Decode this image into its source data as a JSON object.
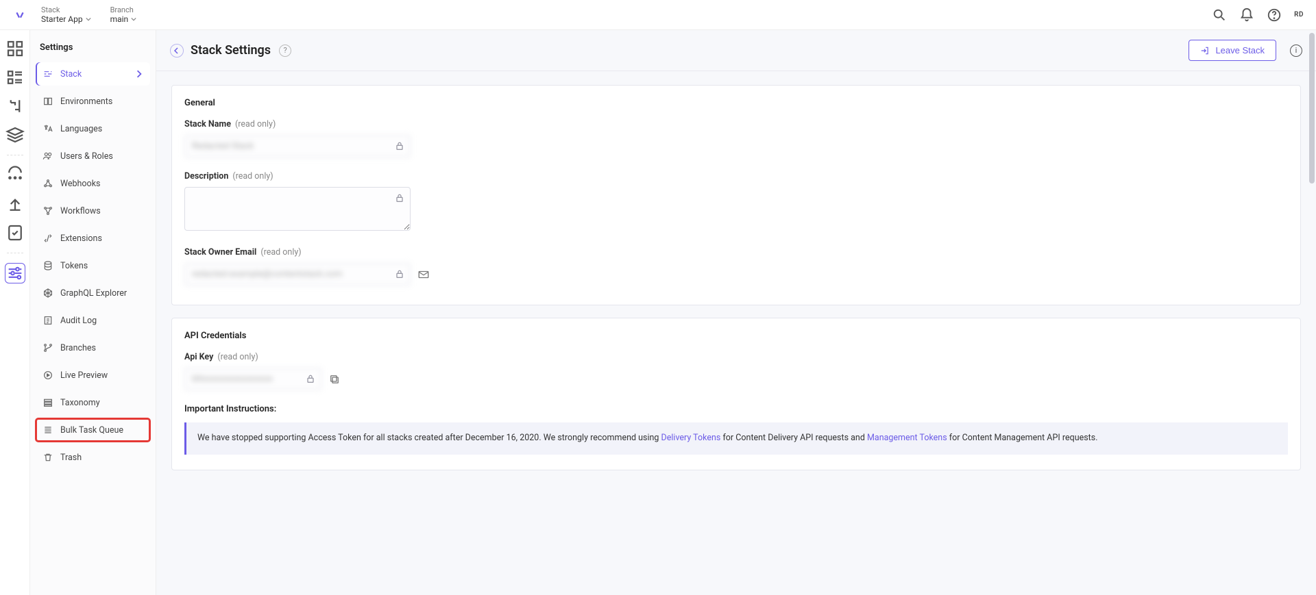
{
  "top": {
    "stack_label": "Stack",
    "stack_value": "Starter App",
    "branch_label": "Branch",
    "branch_value": "main",
    "avatar": "RD"
  },
  "sidebar": {
    "title": "Settings",
    "items": [
      {
        "label": "Stack"
      },
      {
        "label": "Environments"
      },
      {
        "label": "Languages"
      },
      {
        "label": "Users & Roles"
      },
      {
        "label": "Webhooks"
      },
      {
        "label": "Workflows"
      },
      {
        "label": "Extensions"
      },
      {
        "label": "Tokens"
      },
      {
        "label": "GraphQL Explorer"
      },
      {
        "label": "Audit Log"
      },
      {
        "label": "Branches"
      },
      {
        "label": "Live Preview"
      },
      {
        "label": "Taxonomy"
      },
      {
        "label": "Bulk Task Queue"
      },
      {
        "label": "Trash"
      }
    ]
  },
  "page": {
    "title": "Stack Settings",
    "leave_label": "Leave Stack",
    "general": {
      "title": "General",
      "stack_name_label": "Stack Name",
      "readonly": "(read only)",
      "stack_name_value": "Redacted Stack",
      "description_label": "Description",
      "description_value": "",
      "owner_label": "Stack Owner Email",
      "owner_value": "redacted.example@contentstack.com"
    },
    "api": {
      "title": "API Credentials",
      "api_key_label": "Api Key",
      "api_key_value": "bltxxxxxxxxxxxxxxxx",
      "instr_title": "Important Instructions:",
      "note_p1": "We have stopped supporting Access Token for all stacks created after December 16, 2020. We strongly recommend using ",
      "link1": "Delivery Tokens",
      "note_p2": " for Content Delivery API requests and ",
      "link2": "Management Tokens",
      "note_p3": " for Content Management API requests."
    }
  }
}
